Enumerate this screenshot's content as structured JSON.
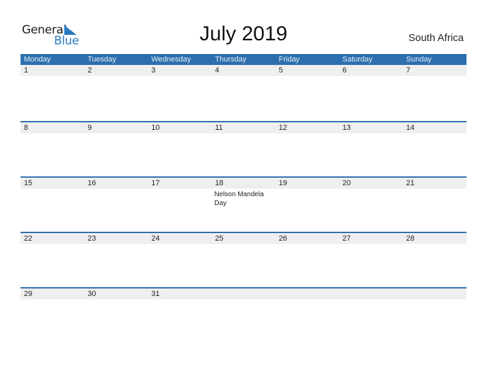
{
  "logo": {
    "word1": "General",
    "word2": "Blue",
    "icon": "triangle-flag-icon"
  },
  "header": {
    "title": "July 2019",
    "country": "South Africa"
  },
  "calendar": {
    "weekdays": [
      "Monday",
      "Tuesday",
      "Wednesday",
      "Thursday",
      "Friday",
      "Saturday",
      "Sunday"
    ],
    "weeks": [
      {
        "dates": [
          "1",
          "2",
          "3",
          "4",
          "5",
          "6",
          "7"
        ],
        "events": [
          "",
          "",
          "",
          "",
          "",
          "",
          ""
        ]
      },
      {
        "dates": [
          "8",
          "9",
          "10",
          "11",
          "12",
          "13",
          "14"
        ],
        "events": [
          "",
          "",
          "",
          "",
          "",
          "",
          ""
        ]
      },
      {
        "dates": [
          "15",
          "16",
          "17",
          "18",
          "19",
          "20",
          "21"
        ],
        "events": [
          "",
          "",
          "",
          "Nelson Mandela Day",
          "",
          "",
          ""
        ]
      },
      {
        "dates": [
          "22",
          "23",
          "24",
          "25",
          "26",
          "27",
          "28"
        ],
        "events": [
          "",
          "",
          "",
          "",
          "",
          "",
          ""
        ]
      },
      {
        "dates": [
          "29",
          "30",
          "31",
          "",
          "",
          "",
          ""
        ],
        "events": [
          "",
          "",
          "",
          "",
          "",
          "",
          ""
        ]
      }
    ]
  },
  "colors": {
    "accent": "#2d6fae",
    "date_strip": "#efefef",
    "logo_blue": "#2a7ac2"
  }
}
